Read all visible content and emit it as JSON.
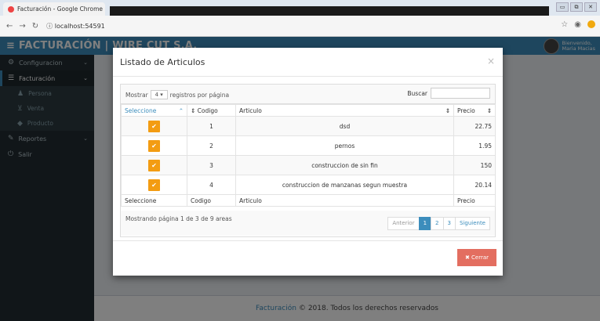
{
  "browser": {
    "tab_title": "Facturación - Google Chrome",
    "url": "localhost:54591",
    "window_controls": [
      "▭",
      "⧉",
      "✕"
    ]
  },
  "app": {
    "brand": "FACTURACIÓN | WIRE CUT S.A.",
    "user_line1": "Bienvenido,",
    "user_line2": "Maria Macias",
    "accent_color": "#3c8dbc"
  },
  "sidebar": {
    "items": [
      {
        "label": "Configuracion",
        "icon": "gear-icon"
      },
      {
        "label": "Facturación",
        "icon": "list-icon"
      },
      {
        "label": "Reportes",
        "icon": "edit-icon"
      },
      {
        "label": "Salir",
        "icon": "power-icon"
      }
    ],
    "sub_items": [
      {
        "label": "Persona",
        "icon": "users-icon"
      },
      {
        "label": "Venta",
        "icon": "cart-icon"
      },
      {
        "label": "Producto",
        "icon": "tag-icon"
      }
    ]
  },
  "footer": {
    "brand": "Facturación",
    "text": "© 2018. Todos los derechos reservados"
  },
  "modal": {
    "title": "Listado de Articulos",
    "close_glyph": "×",
    "show_prefix": "Mostrar",
    "show_value": "4 ▾",
    "show_suffix": "registros por página",
    "search_label": "Buscar",
    "search_value": "",
    "columns": [
      "Seleccione",
      "Codigo",
      "Articulo",
      "Precio"
    ],
    "footer_columns": [
      "Seleccione",
      "Codigo",
      "Articulo",
      "Precio"
    ],
    "rows": [
      {
        "codigo": "1",
        "articulo": "dsd",
        "precio": "22.75"
      },
      {
        "codigo": "2",
        "articulo": "pernos",
        "precio": "1.95"
      },
      {
        "codigo": "3",
        "articulo": "construccion de sin fin",
        "precio": "150"
      },
      {
        "codigo": "4",
        "articulo": "construccion de manzanas segun muestra",
        "precio": "20.14"
      }
    ],
    "info": "Mostrando página 1 de 3 de 9 areas",
    "pager": {
      "prev": "Anterior",
      "pages": [
        "1",
        "2",
        "3"
      ],
      "next": "Siguiente",
      "current": "1"
    },
    "close_button": "✖ Cerrar",
    "select_color": "#f39c12"
  }
}
